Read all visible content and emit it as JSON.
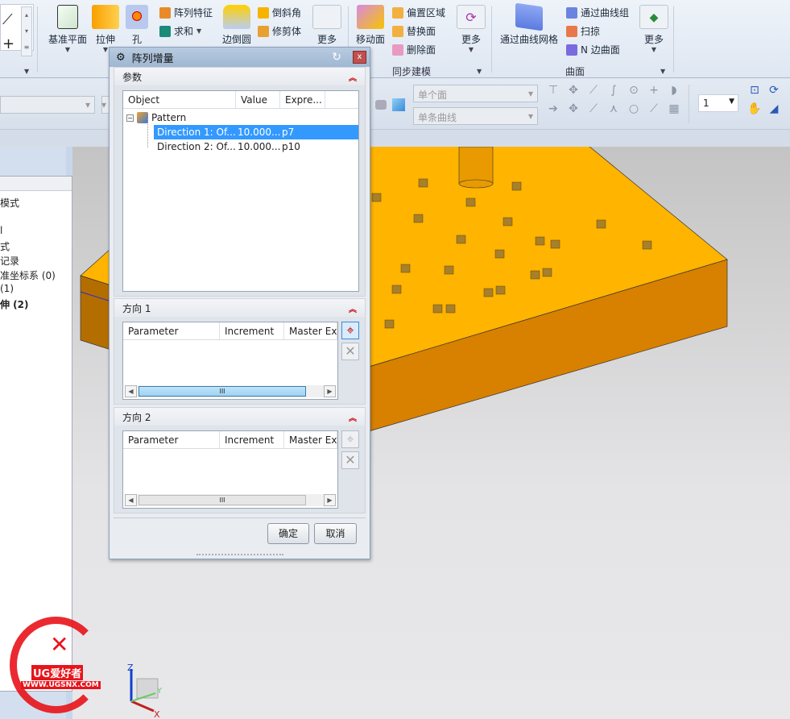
{
  "ribbon": {
    "feature": {
      "datum_plane": "基准平面",
      "extrude": "拉伸",
      "hole": "孔",
      "pattern_feature": "阵列特征",
      "unite": "求和",
      "edge_blend": "边倒圆",
      "chamfer": "倒斜角",
      "trim_body": "修剪体",
      "more": "更多"
    },
    "sync": {
      "move_face": "移动面",
      "offset_region": "偏置区域",
      "replace_face": "替换面",
      "delete_face": "删除面",
      "more": "更多",
      "group": "同步建模"
    },
    "surface": {
      "through_curve_mesh": "通过曲线网格",
      "through_curves": "通过曲线组",
      "swept": "扫掠",
      "n_sided": "N 边曲面",
      "more": "更多",
      "group": "曲面"
    }
  },
  "selection_bar": {
    "face_rule": "单个面",
    "curve_rule": "单条曲线",
    "layer_value": "1"
  },
  "nav_tree": {
    "items": [
      "模式",
      "l",
      "式",
      "记录",
      "准坐标系 (0)",
      "(1)",
      "伸 (2)"
    ]
  },
  "dialog": {
    "title": "阵列增量",
    "params_section": "参数",
    "columns": [
      "Object",
      "Value",
      "Expre..."
    ],
    "root": "Pattern",
    "rows": [
      {
        "object": "Direction 1: Of...",
        "value": "10.000...",
        "expr": "p7",
        "selected": true
      },
      {
        "object": "Direction 2: Of...",
        "value": "10.000...",
        "expr": "p10",
        "selected": false
      }
    ],
    "dir1": {
      "title": "方向 1",
      "columns": [
        "Parameter",
        "Increment",
        "Master Ex"
      ]
    },
    "dir2": {
      "title": "方向 2",
      "columns": [
        "Parameter",
        "Increment",
        "Master Ex"
      ]
    },
    "ok": "确定",
    "cancel": "取消"
  },
  "watermark": {
    "brand": "UG爱好者",
    "url": "WWW.UGSNX.COM"
  },
  "triad": {
    "x": "X",
    "y": "Y",
    "z": "Z"
  }
}
